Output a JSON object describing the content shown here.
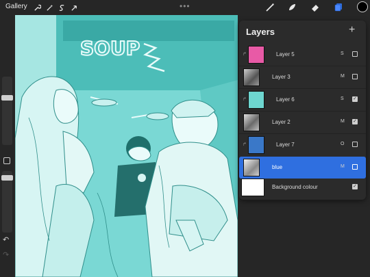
{
  "toolbar": {
    "gallery_label": "Gallery",
    "left_tools": [
      "wrench-icon",
      "magic-wand-icon",
      "selection-icon",
      "transform-arrow-icon"
    ],
    "more_glyph": "•••",
    "right_tools": [
      "brush-icon",
      "smudge-icon",
      "eraser-icon",
      "layers-icon"
    ],
    "current_color": "#000000"
  },
  "layers": {
    "title": "Layers",
    "add_glyph": "+",
    "items": [
      {
        "name": "Layer 5",
        "mode": "S",
        "visible": false,
        "thumb_color": "#e85aa6",
        "clipped": true
      },
      {
        "name": "Layer 3",
        "mode": "M",
        "visible": false,
        "thumb_color": "#8a8a8a",
        "clipped": false
      },
      {
        "name": "Layer 6",
        "mode": "S",
        "visible": true,
        "thumb_color": "#6ed6d0",
        "clipped": true
      },
      {
        "name": "Layer 2",
        "mode": "M",
        "visible": true,
        "thumb_color": "#9a9a9a",
        "clipped": false
      },
      {
        "name": "Layer 7",
        "mode": "O",
        "visible": false,
        "thumb_color": "#3a78c8",
        "clipped": true
      },
      {
        "name": "blue",
        "mode": "M",
        "visible": false,
        "thumb_color": "#b8b8b8",
        "clipped": false,
        "selected": true
      },
      {
        "name": "Background colour",
        "mode": "",
        "visible": true,
        "thumb_color": "#ffffff",
        "clipped": false
      }
    ]
  },
  "canvas": {
    "sign_text": "SOUP",
    "base_color": "#7ad8d4"
  },
  "sidebar": {
    "undo_glyph": "↶",
    "redo_glyph": "↷"
  }
}
